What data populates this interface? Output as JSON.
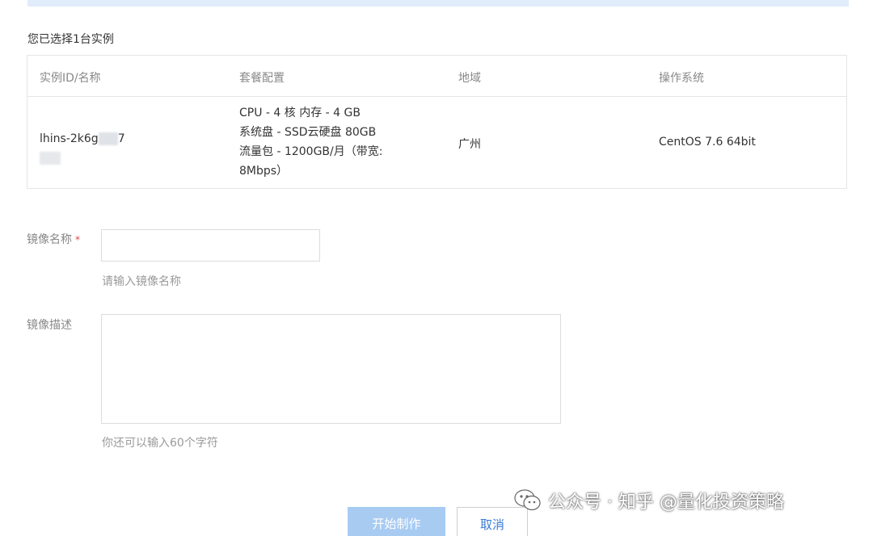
{
  "selection": {
    "note": "您已选择1台实例"
  },
  "table": {
    "headers": [
      "实例ID/名称",
      "套餐配置",
      "地域",
      "操作系统"
    ],
    "row": {
      "instance_id_prefix": "lhins-2k6g",
      "instance_id_suffix": "7",
      "package_lines": [
        "CPU - 4 核 内存 - 4 GB",
        "系统盘 - SSD云硬盘 80GB",
        "流量包 - 1200GB/月（带宽:",
        "8Mbps）"
      ],
      "region": "广州",
      "os": "CentOS 7.6 64bit"
    }
  },
  "form": {
    "image_name_label": "镜像名称",
    "required_mark": "*",
    "image_name_value": "",
    "image_name_hint": "请输入镜像名称",
    "image_desc_label": "镜像描述",
    "image_desc_value": "",
    "image_desc_hint": "你还可以输入60个字符"
  },
  "actions": {
    "start_label": "开始制作",
    "cancel_label": "取消"
  },
  "watermark": {
    "text": "公众号 · 知乎 @量化投资策略",
    "icon": "wechat-icon"
  },
  "colors": {
    "primary_disabled": "#a8cbf2",
    "link_blue": "#3a7bd5",
    "required_red": "#e54545",
    "top_bar": "#e1ecfb"
  }
}
